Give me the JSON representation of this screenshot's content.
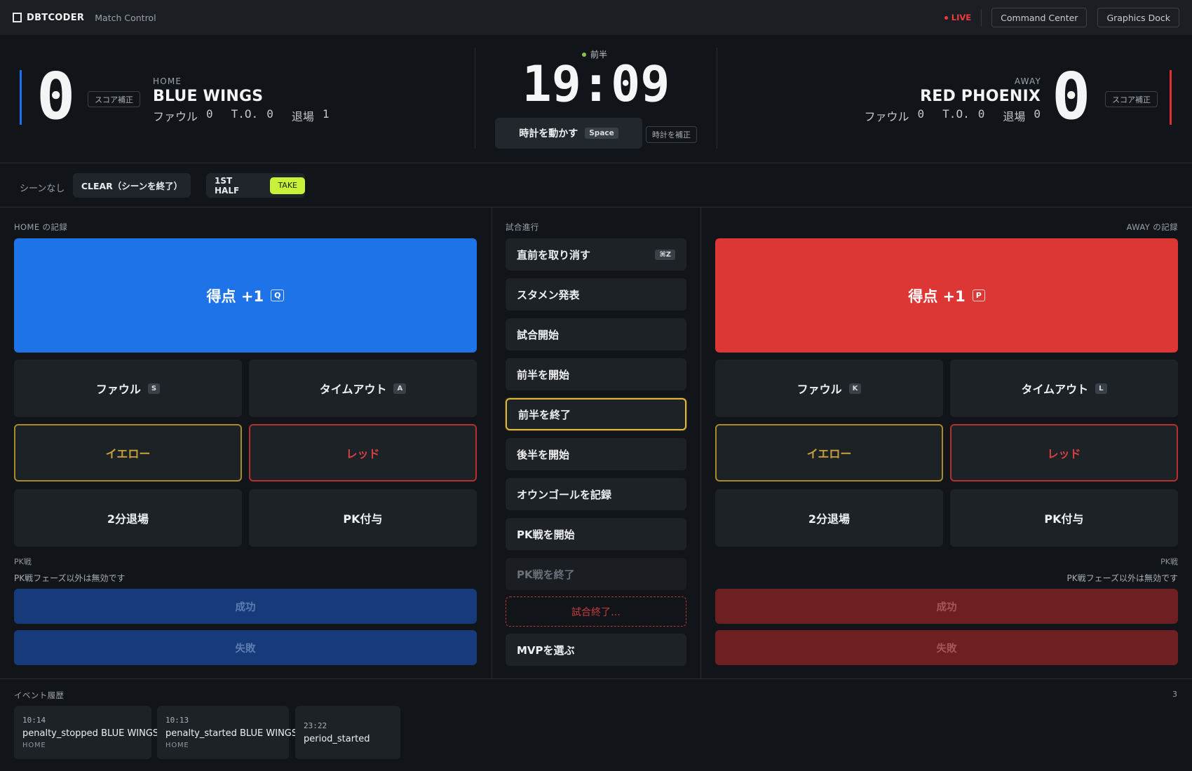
{
  "topbar": {
    "brand": "DBTCODER",
    "subtitle": "Match Control",
    "live_label": "LIVE",
    "command_center": "Command Center",
    "graphics_dock": "Graphics Dock"
  },
  "colors": {
    "home_accent": "#1e73e8",
    "away_accent": "#dc3734",
    "take_accent": "#c8f23a",
    "live_red": "#ef3b3b",
    "active_outline": "#e0b53c"
  },
  "home": {
    "side_label": "HOME",
    "name": "BLUE WINGS",
    "score": "0",
    "score_fix": "スコア補正",
    "foul_label": "ファウル",
    "foul_value": "0",
    "to_label": "T.O.",
    "to_value": "0",
    "ejection_label": "退場",
    "ejection_value": "1"
  },
  "away": {
    "side_label": "AWAY",
    "name": "RED PHOENIX",
    "score": "0",
    "score_fix": "スコア補正",
    "foul_label": "ファウル",
    "foul_value": "0",
    "to_label": "T.O.",
    "to_value": "0",
    "ejection_label": "退場",
    "ejection_value": "0"
  },
  "clock": {
    "period": "前半",
    "time": "19:09",
    "run_label": "時計を動かす",
    "run_key": "Space",
    "fix_label": "時計を補正"
  },
  "scene": {
    "none_label": "シーンなし",
    "clear_label": "CLEAR（シーンを終了）",
    "card_name": "1ST HALF",
    "take_label": "TAKE"
  },
  "panels": {
    "home_title": "HOME の記録",
    "mid_title": "試合進行",
    "away_title": "AWAY の記録"
  },
  "home_actions": {
    "goal_label": "得点 +1",
    "goal_key": "Q",
    "foul_label": "ファウル",
    "foul_key": "S",
    "timeout_label": "タイムアウト",
    "timeout_key": "A",
    "yellow": "イエロー",
    "red": "レッド",
    "two_min": "2分退場",
    "pk_award": "PK付与",
    "pk_title": "PK戦",
    "pk_note": "PK戦フェーズ以外は無効です",
    "pk_success": "成功",
    "pk_fail": "失敗"
  },
  "away_actions": {
    "goal_label": "得点 +1",
    "goal_key": "P",
    "foul_label": "ファウル",
    "foul_key": "K",
    "timeout_label": "タイムアウト",
    "timeout_key": "L",
    "yellow": "イエロー",
    "red": "レッド",
    "two_min": "2分退場",
    "pk_award": "PK付与",
    "pk_title": "PK戦",
    "pk_note": "PK戦フェーズ以外は無効です",
    "pk_success": "成功",
    "pk_fail": "失敗"
  },
  "progress": {
    "undo": "直前を取り消す",
    "undo_key": "⌘Z",
    "lineup": "スタメン発表",
    "start_match": "試合開始",
    "start_first": "前半を開始",
    "end_first": "前半を終了",
    "start_second": "後半を開始",
    "own_goal": "オウンゴールを記録",
    "start_pk": "PK戦を開始",
    "end_pk": "PK戦を終了",
    "end_match": "試合終了…",
    "mvp": "MVPを選ぶ"
  },
  "events": {
    "title": "イベント履歴",
    "count": "3",
    "items": [
      {
        "time": "10:14",
        "text": "penalty_stopped BLUE WINGS",
        "side": "HOME"
      },
      {
        "time": "10:13",
        "text": "penalty_started BLUE WINGS",
        "side": "HOME"
      },
      {
        "time": "23:22",
        "text": "period_started",
        "side": ""
      }
    ]
  }
}
